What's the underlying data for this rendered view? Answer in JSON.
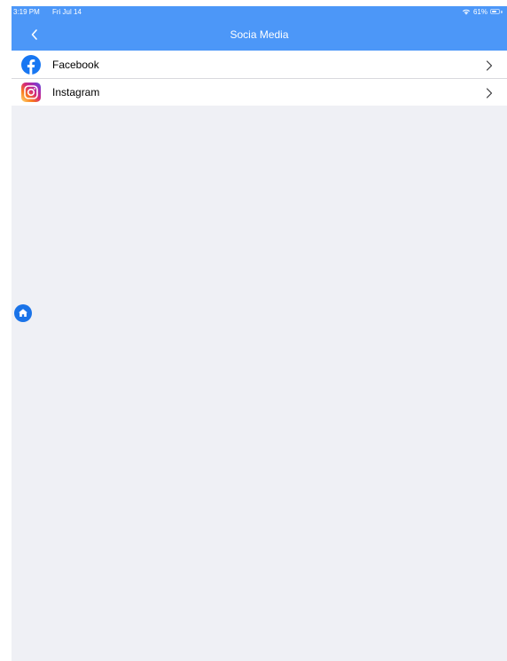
{
  "status_bar": {
    "time": "3:19 PM",
    "date": "Fri Jul 14",
    "battery": "61%",
    "icons": [
      "wifi-icon",
      "battery-icon"
    ]
  },
  "navbar": {
    "title": "Socia Media",
    "back_icon": "chevron-left-icon"
  },
  "list": {
    "items": [
      {
        "label": "Facebook",
        "icon": "facebook-icon"
      },
      {
        "label": "Instagram",
        "icon": "instagram-icon"
      }
    ],
    "trailing_icon": "chevron-right-icon"
  },
  "floating": {
    "home_icon": "home-icon"
  },
  "colors": {
    "header": "#4c97f8",
    "background": "#eff0f5",
    "facebook": "#1877f2",
    "home_button": "#1a73e8"
  }
}
